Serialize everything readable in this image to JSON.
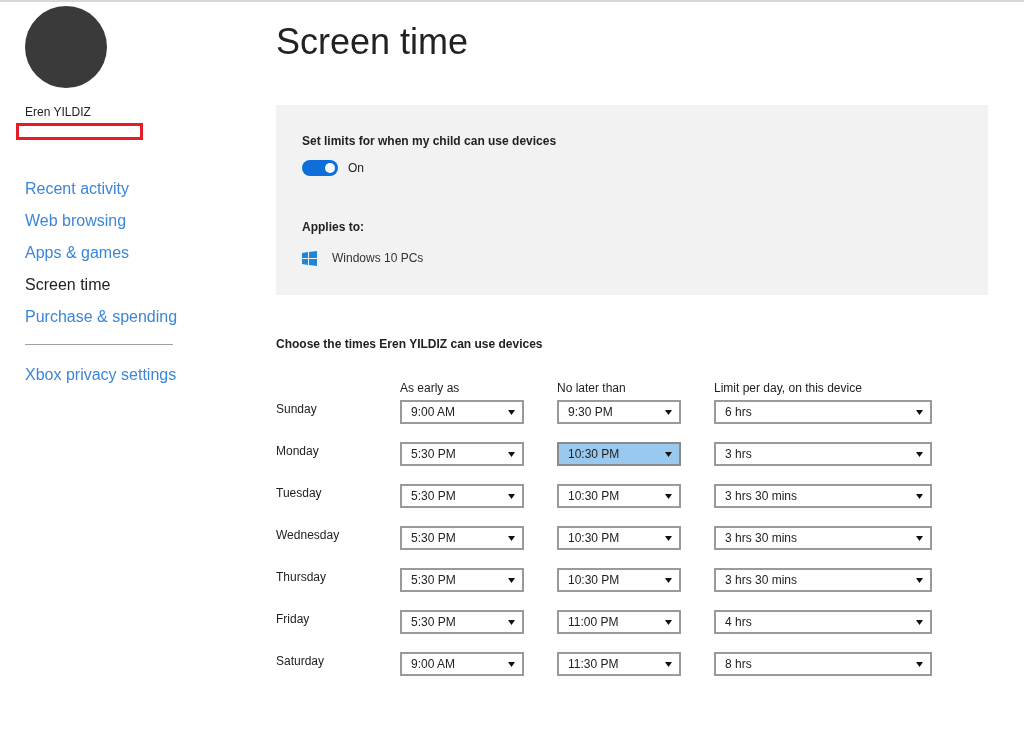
{
  "profile": {
    "name": "Eren YILDIZ"
  },
  "sidebar": {
    "items": [
      {
        "label": "Recent activity",
        "selected": false
      },
      {
        "label": "Web browsing",
        "selected": false
      },
      {
        "label": "Apps & games",
        "selected": false
      },
      {
        "label": "Screen time",
        "selected": true
      },
      {
        "label": "Purchase & spending",
        "selected": false
      }
    ],
    "extra_links": [
      {
        "label": "Xbox privacy settings"
      }
    ]
  },
  "page": {
    "title": "Screen time"
  },
  "limits_panel": {
    "toggle_label": "Set limits for when my child can use devices",
    "on": true,
    "state_text": "On",
    "applies_heading": "Applies to:",
    "device": "Windows 10 PCs"
  },
  "schedule": {
    "heading": "Choose the times Eren YILDIZ can use devices",
    "columns": [
      "As early as",
      "No later than",
      "Limit per day, on this device"
    ],
    "rows": [
      {
        "day": "Sunday",
        "cells": [
          {
            "value": "9:00 AM",
            "highlighted": false
          },
          {
            "value": "9:30 PM",
            "highlighted": false
          },
          {
            "value": "6 hrs",
            "highlighted": false
          }
        ]
      },
      {
        "day": "Monday",
        "cells": [
          {
            "value": "5:30 PM",
            "highlighted": false
          },
          {
            "value": "10:30 PM",
            "highlighted": true
          },
          {
            "value": "3 hrs",
            "highlighted": false
          }
        ]
      },
      {
        "day": "Tuesday",
        "cells": [
          {
            "value": "5:30 PM",
            "highlighted": false
          },
          {
            "value": "10:30 PM",
            "highlighted": false
          },
          {
            "value": "3 hrs 30 mins",
            "highlighted": false
          }
        ]
      },
      {
        "day": "Wednesday",
        "cells": [
          {
            "value": "5:30 PM",
            "highlighted": false
          },
          {
            "value": "10:30 PM",
            "highlighted": false
          },
          {
            "value": "3 hrs 30 mins",
            "highlighted": false
          }
        ]
      },
      {
        "day": "Thursday",
        "cells": [
          {
            "value": "5:30 PM",
            "highlighted": false
          },
          {
            "value": "10:30 PM",
            "highlighted": false
          },
          {
            "value": "3 hrs 30 mins",
            "highlighted": false
          }
        ]
      },
      {
        "day": "Friday",
        "cells": [
          {
            "value": "5:30 PM",
            "highlighted": false
          },
          {
            "value": "11:00 PM",
            "highlighted": false
          },
          {
            "value": "4 hrs",
            "highlighted": false
          }
        ]
      },
      {
        "day": "Saturday",
        "cells": [
          {
            "value": "9:00 AM",
            "highlighted": false
          },
          {
            "value": "11:30 PM",
            "highlighted": false
          },
          {
            "value": "8 hrs",
            "highlighted": false
          }
        ]
      }
    ]
  }
}
